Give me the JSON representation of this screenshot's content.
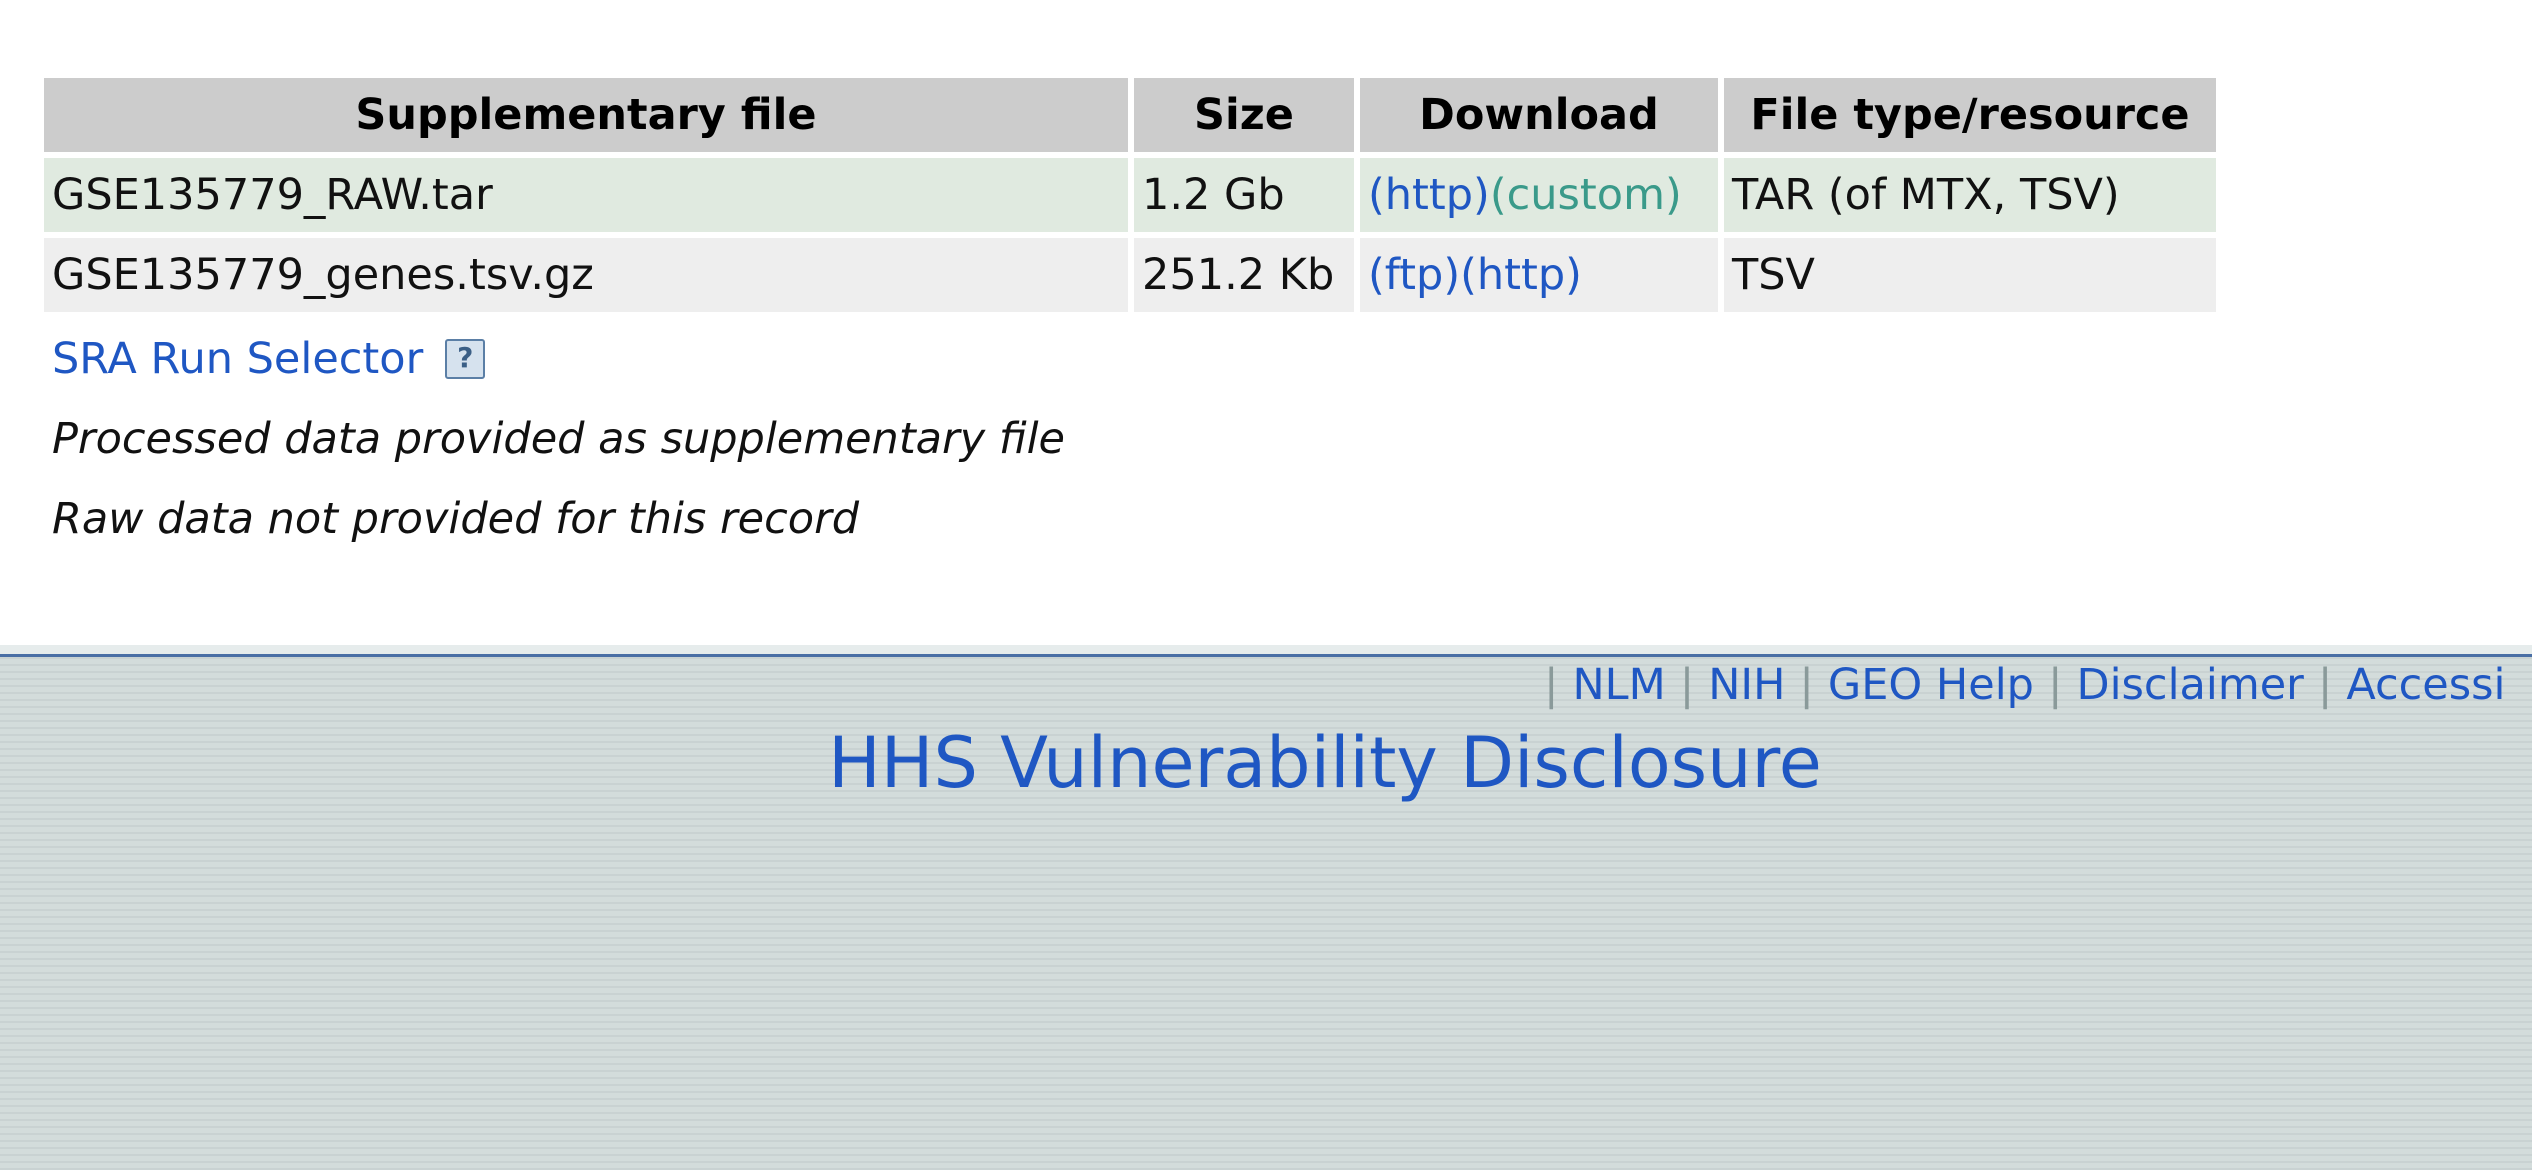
{
  "table": {
    "headers": [
      "Supplementary file",
      "Size",
      "Download",
      "File type/resource"
    ],
    "rows": [
      {
        "file": "GSE135779_RAW.tar",
        "size": "1.2 Gb",
        "links": [
          "(http)",
          "(custom)"
        ],
        "type": "TAR (of MTX, TSV)"
      },
      {
        "file": "GSE135779_genes.tsv.gz",
        "size": "251.2 Kb",
        "links": [
          "(ftp)",
          "(http)"
        ],
        "type": "TSV"
      }
    ]
  },
  "sra_link": "SRA Run Selector",
  "help_icon": "?",
  "notes": {
    "processed": "Processed data provided as supplementary file",
    "raw": "Raw data not provided for this record"
  },
  "footer": {
    "separator": "|",
    "links": [
      "NLM",
      "NIH",
      "GEO Help",
      "Disclaimer",
      "Accessi"
    ],
    "vulnerability": "HHS Vulnerability Disclosure"
  },
  "colors": {
    "link": "#1f57c3",
    "custom_link": "#3a9a8a",
    "header_bg": "#cccccc",
    "row_even_bg": "#e0eae0",
    "row_odd_bg": "#eeeeee",
    "footer_bg": "#d3dcdb",
    "footer_rule": "#4a6fa5"
  }
}
